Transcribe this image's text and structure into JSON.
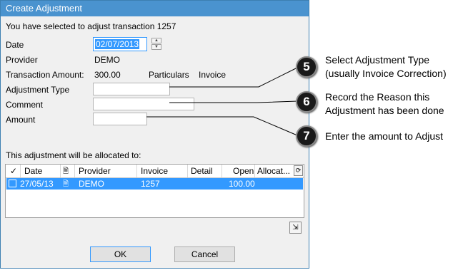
{
  "window": {
    "title": "Create Adjustment"
  },
  "intro": "You have selected to adjust transaction 1257",
  "form": {
    "date_label": "Date",
    "date_value": "02/07/2013",
    "provider_label": "Provider",
    "provider_value": "DEMO",
    "amount_label": "Transaction Amount:",
    "amount_value": "300.00",
    "particulars_label": "Particulars",
    "particulars_value": "Invoice",
    "adjustment_type_label": "Adjustment Type",
    "adjustment_type_value": "",
    "comment_label": "Comment",
    "comment_value": "",
    "amount_entry_label": "Amount",
    "amount_entry_value": ""
  },
  "allocation": {
    "label": "This adjustment will be allocated to:",
    "columns": [
      "✓",
      "Date",
      "",
      "Provider",
      "Invoice",
      "Detail",
      "Open",
      "Allocat..."
    ],
    "rows": [
      {
        "checked": false,
        "date": "27/05/13",
        "provider": "DEMO",
        "invoice": "1257",
        "detail": "",
        "open": "100.00",
        "allocated": ""
      }
    ]
  },
  "buttons": {
    "ok": "OK",
    "cancel": "Cancel"
  },
  "callouts": [
    {
      "number": "5",
      "text_line1": "Select Adjustment Type",
      "text_line2": "(usually Invoice Correction)"
    },
    {
      "number": "6",
      "text_line1": "Record the Reason this",
      "text_line2": "Adjustment has been done"
    },
    {
      "number": "7",
      "text_line1": "Enter the amount to Adjust",
      "text_line2": ""
    }
  ],
  "colors": {
    "titlebar": "#4a93cf",
    "selection": "#3399ff",
    "dialog_bg": "#f0f0f0"
  }
}
